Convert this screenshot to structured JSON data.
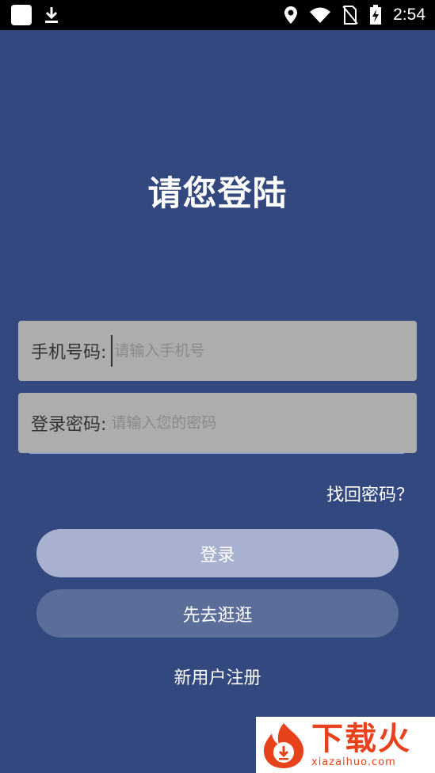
{
  "status_bar": {
    "time": "2:54"
  },
  "page": {
    "title": "请您登陆"
  },
  "form": {
    "phone": {
      "label": "手机号码:",
      "placeholder": "请输入手机号",
      "value": ""
    },
    "password": {
      "label": "登录密码:",
      "placeholder": "请输入您的密码",
      "value": ""
    }
  },
  "links": {
    "forgot_password": "找回密码？",
    "register": "新用户注册"
  },
  "buttons": {
    "login": "登录",
    "browse": "先去逛逛"
  },
  "watermark": {
    "brand": "下载火",
    "domain": "xiazaihuo.com"
  },
  "colors": {
    "background": "#32487e",
    "field": "#adadad",
    "login_button": "#a8b2d0",
    "browse_button": "#5b6d99",
    "watermark": "#e8421c"
  }
}
